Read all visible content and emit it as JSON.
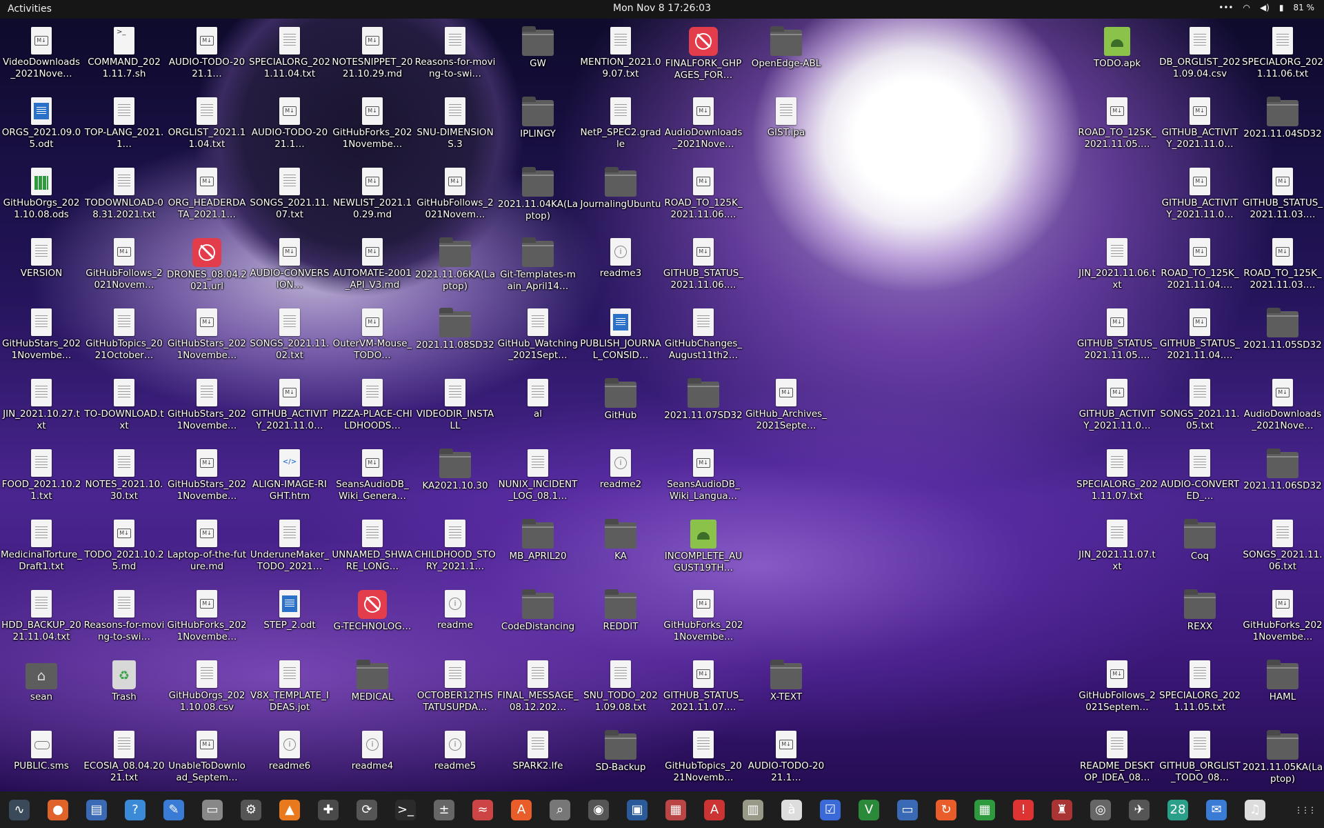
{
  "topbar": {
    "activities": "Activities",
    "clock": "Mon Nov 8  17:26:03",
    "battery": "81 %"
  },
  "icons": [
    {
      "label": "VideoDownloads_2021Nove…",
      "type": "md"
    },
    {
      "label": "COMMAND_2021.11.7.sh",
      "type": "term"
    },
    {
      "label": "AUDIO-TODO-2021.1…",
      "type": "md"
    },
    {
      "label": "SPECIALORG_2021.11.04.txt",
      "type": "doc"
    },
    {
      "label": "NOTESNIPPET_2021.10.29.md",
      "type": "md"
    },
    {
      "label": "Reasons-for-moving-to-swi…",
      "type": "doc"
    },
    {
      "label": "GW",
      "type": "folder"
    },
    {
      "label": "MENTION_2021.09.07.txt",
      "type": "doc"
    },
    {
      "label": "FINALFORK_GHPAGES_FOR…",
      "type": "red"
    },
    {
      "label": "OpenEdge-ABL",
      "type": "folder"
    },
    {
      "label": "TODO.apk",
      "type": "apk"
    },
    {
      "label": "DB_ORGLIST_2021.09.04.csv",
      "type": "doc"
    },
    {
      "label": "SPECIALORG_2021.11.06.txt",
      "type": "doc"
    },
    {
      "label": "ORGS_2021.09.05.odt",
      "type": "odt"
    },
    {
      "label": "TOP-LANG_2021.1…",
      "type": "doc"
    },
    {
      "label": "ORGLIST_2021.11.04.txt",
      "type": "doc"
    },
    {
      "label": "AUDIO-TODO-2021.1…",
      "type": "md"
    },
    {
      "label": "GitHubForks_2021Novembe…",
      "type": "md"
    },
    {
      "label": "SNU-DIMENSIONS.3",
      "type": "doc"
    },
    {
      "label": "IPLINGY",
      "type": "folder"
    },
    {
      "label": "NetP_SPEC2.gradle",
      "type": "doc"
    },
    {
      "label": "AudioDownloads_2021Nove…",
      "type": "md"
    },
    {
      "label": "GIST.ipa",
      "type": "doc"
    },
    {
      "label": "ROAD_TO_125K_2021.11.05.…",
      "type": "md"
    },
    {
      "label": "GITHUB_ACTIVITY_2021.11.0…",
      "type": "md"
    },
    {
      "label": "2021.11.04SD32",
      "type": "folder"
    },
    {
      "label": "GitHubOrgs_2021.10.08.ods",
      "type": "ods"
    },
    {
      "label": "TODOWNLOAD-08.31.2021.txt",
      "type": "doc"
    },
    {
      "label": "ORG_HEADERDATA_2021.1…",
      "type": "md"
    },
    {
      "label": "SONGS_2021.11.07.txt",
      "type": "doc"
    },
    {
      "label": "NEWLIST_2021.10.29.md",
      "type": "md"
    },
    {
      "label": "GitHubFollows_2021Novem…",
      "type": "md"
    },
    {
      "label": "2021.11.04KA(Laptop)",
      "type": "folder"
    },
    {
      "label": "JournalingUbuntu",
      "type": "folder"
    },
    {
      "label": "ROAD_TO_125K_2021.11.06.…",
      "type": "md"
    },
    {
      "label": "GITHUB_ACTIVITY_2021.11.0…",
      "type": "md"
    },
    {
      "label": "GITHUB_STATUS_2021.11.03.…",
      "type": "md"
    },
    {
      "label": "VERSION",
      "type": "doc"
    },
    {
      "label": "GitHubFollows_2021Novem…",
      "type": "md"
    },
    {
      "label": "DRONES_08.04.2021.url",
      "type": "red"
    },
    {
      "label": "AUDIO-CONVERSION…",
      "type": "md"
    },
    {
      "label": "AUTOMATE-2001_API_V3.md",
      "type": "md"
    },
    {
      "label": "2021.11.06KA(Laptop)",
      "type": "folder"
    },
    {
      "label": "Git-Templates-main_April14…",
      "type": "folder"
    },
    {
      "label": "readme3",
      "type": "info"
    },
    {
      "label": "GITHUB_STATUS_2021.11.06.…",
      "type": "md"
    },
    {
      "label": "JIN_2021.11.06.txt",
      "type": "doc"
    },
    {
      "label": "ROAD_TO_125K_2021.11.04.…",
      "type": "md"
    },
    {
      "label": "ROAD_TO_125K_2021.11.03.…",
      "type": "md"
    },
    {
      "label": "GitHubStars_2021Novembe…",
      "type": "doc"
    },
    {
      "label": "GitHubTopics_2021October…",
      "type": "doc"
    },
    {
      "label": "GitHubStars_2021Novembe…",
      "type": "md"
    },
    {
      "label": "SONGS_2021.11.02.txt",
      "type": "doc"
    },
    {
      "label": "OuterVM-Mouse_TODO…",
      "type": "md"
    },
    {
      "label": "2021.11.08SD32",
      "type": "folder"
    },
    {
      "label": "GitHub_Watching_2021Sept…",
      "type": "doc"
    },
    {
      "label": "PUBLISH_JOURNAL_CONSID…",
      "type": "odt"
    },
    {
      "label": "GitHubChanges_August11th2…",
      "type": "doc"
    },
    {
      "label": "GITHUB_STATUS_2021.11.05.…",
      "type": "md"
    },
    {
      "label": "GITHUB_STATUS_2021.11.04.…",
      "type": "md"
    },
    {
      "label": "2021.11.05SD32",
      "type": "folder"
    },
    {
      "label": "JIN_2021.10.27.txt",
      "type": "doc"
    },
    {
      "label": "TO-DOWNLOAD.txt",
      "type": "doc"
    },
    {
      "label": "GitHubStars_2021Novembe…",
      "type": "doc"
    },
    {
      "label": "GITHUB_ACTIVITY_2021.11.0…",
      "type": "md"
    },
    {
      "label": "PIZZA-PLACE-CHILDHOODS…",
      "type": "doc"
    },
    {
      "label": "VIDEODIR_INSTALL",
      "type": "doc"
    },
    {
      "label": "al",
      "type": "doc"
    },
    {
      "label": "GitHub",
      "type": "folder"
    },
    {
      "label": "2021.11.07SD32",
      "type": "folder"
    },
    {
      "label": "GitHub_Archives_2021Septe…",
      "type": "md"
    },
    {
      "label": "GITHUB_ACTIVITY_2021.11.0…",
      "type": "md"
    },
    {
      "label": "SONGS_2021.11.05.txt",
      "type": "doc"
    },
    {
      "label": "AudioDownloads_2021Nove…",
      "type": "md"
    },
    {
      "label": "FOOD_2021.10.21.txt",
      "type": "doc"
    },
    {
      "label": "NOTES_2021.10.30.txt",
      "type": "doc"
    },
    {
      "label": "GitHubStars_2021Novembe…",
      "type": "md"
    },
    {
      "label": "ALIGN-IMAGE-RIGHT.htm",
      "type": "htm"
    },
    {
      "label": "SeansAudioDB_Wiki_Genera…",
      "type": "md"
    },
    {
      "label": "KA2021.10.30",
      "type": "folder"
    },
    {
      "label": "NUNIX_INCIDENT_LOG_08.1…",
      "type": "doc"
    },
    {
      "label": "readme2",
      "type": "info"
    },
    {
      "label": "SeansAudioDB_Wiki_Langua…",
      "type": "md"
    },
    {
      "label": "SPECIALORG_2021.11.07.txt",
      "type": "doc"
    },
    {
      "label": "AUDIO-CONVERTED_…",
      "type": "doc"
    },
    {
      "label": "2021.11.06SD32",
      "type": "folder"
    },
    {
      "label": "MedicinalTorture_Draft1.txt",
      "type": "doc"
    },
    {
      "label": "TODO_2021.10.25.md",
      "type": "md"
    },
    {
      "label": "Laptop-of-the-future.md",
      "type": "md"
    },
    {
      "label": "UnderuneMaker_TODO_2021…",
      "type": "doc"
    },
    {
      "label": "UNNAMED_SHWARE_LONG…",
      "type": "doc"
    },
    {
      "label": "CHILDHOOD_STORY_2021.1…",
      "type": "doc"
    },
    {
      "label": "MB_APRIL20",
      "type": "folder"
    },
    {
      "label": "KA",
      "type": "folder"
    },
    {
      "label": "INCOMPLETE_AUGUST19TH…",
      "type": "apk"
    },
    {
      "label": "JIN_2021.11.07.txt",
      "type": "doc"
    },
    {
      "label": "Coq",
      "type": "folder"
    },
    {
      "label": "SONGS_2021.11.06.txt",
      "type": "doc"
    },
    {
      "label": "HDD_BACKUP_2021.11.04.txt",
      "type": "doc"
    },
    {
      "label": "Reasons-for-moving-to-swi…",
      "type": "doc"
    },
    {
      "label": "GitHubForks_2021Novembe…",
      "type": "md"
    },
    {
      "label": "STEP_2.odt",
      "type": "odt"
    },
    {
      "label": "G-TECHNOLOG…",
      "type": "red"
    },
    {
      "label": "readme",
      "type": "info"
    },
    {
      "label": "CodeDistancing",
      "type": "folder"
    },
    {
      "label": "REDDIT",
      "type": "folder"
    },
    {
      "label": "GitHubForks_2021Novembe…",
      "type": "md"
    },
    {
      "label": "REXX",
      "type": "folder"
    },
    {
      "label": "GitHubForks_2021Novembe…",
      "type": "md"
    },
    {
      "label": "sean",
      "type": "home"
    },
    {
      "label": "Trash",
      "type": "trash"
    },
    {
      "label": "GitHubOrgs_2021.10.08.csv",
      "type": "doc"
    },
    {
      "label": "V8X_TEMPLATE_IDEAS.jot",
      "type": "doc"
    },
    {
      "label": "MEDICAL",
      "type": "folder"
    },
    {
      "label": "OCTOBER12THSTATUSUPDA…",
      "type": "doc"
    },
    {
      "label": "FINAL_MESSAGE_08.12.202…",
      "type": "doc"
    },
    {
      "label": "SNU_TODO_2021.09.08.txt",
      "type": "doc"
    },
    {
      "label": "GITHUB_STATUS_2021.11.07.…",
      "type": "md"
    },
    {
      "label": "X-TEXT",
      "type": "folder"
    },
    {
      "label": "GitHubFollows_2021Septem…",
      "type": "md"
    },
    {
      "label": "SPECIALORG_2021.11.05.txt",
      "type": "doc"
    },
    {
      "label": "HAML",
      "type": "folder"
    },
    {
      "label": "PUBLIC.sms",
      "type": "game"
    },
    {
      "label": "ECOSIA_08.04.2021.txt",
      "type": "doc"
    },
    {
      "label": "UnableToDownload_Septem…",
      "type": "md"
    },
    {
      "label": "readme6",
      "type": "info"
    },
    {
      "label": "readme4",
      "type": "info"
    },
    {
      "label": "readme5",
      "type": "info"
    },
    {
      "label": "SPARK2.lfe",
      "type": "doc"
    },
    {
      "label": "SD-Backup",
      "type": "folder"
    },
    {
      "label": "GitHubTopics_2021Novemb…",
      "type": "doc"
    },
    {
      "label": "AUDIO-TODO-2021.1…",
      "type": "md"
    },
    {
      "label": "README_DESKTOP_IDEA_08…",
      "type": "doc"
    },
    {
      "label": "GITHUB_ORGLIST_TODO_08…",
      "type": "doc"
    },
    {
      "label": "2021.11.05KA(Laptop)",
      "type": "folder"
    }
  ],
  "dock": [
    {
      "name": "system-monitor-icon",
      "glyph": "∿",
      "color": "#3a4a5a"
    },
    {
      "name": "firefox-icon",
      "glyph": "●",
      "color": "#e0632a"
    },
    {
      "name": "document-viewer-icon",
      "glyph": "▤",
      "color": "#3a6ab5"
    },
    {
      "name": "help-icon",
      "glyph": "?",
      "color": "#3a8ad8"
    },
    {
      "name": "text-editor-icon",
      "glyph": "✎",
      "color": "#3a7bd5"
    },
    {
      "name": "files-icon",
      "glyph": "▭",
      "color": "#888"
    },
    {
      "name": "settings-icon",
      "glyph": "⚙",
      "color": "#555"
    },
    {
      "name": "vlc-icon",
      "glyph": "▲",
      "color": "#e8791c"
    },
    {
      "name": "extensions-icon",
      "glyph": "✚",
      "color": "#4a4a4a"
    },
    {
      "name": "updater-icon",
      "glyph": "⟳",
      "color": "#555"
    },
    {
      "name": "terminal-icon",
      "glyph": ">_",
      "color": "#2b2b2b"
    },
    {
      "name": "calculator-icon",
      "glyph": "±",
      "color": "#666"
    },
    {
      "name": "audio-editor-icon",
      "glyph": "≈",
      "color": "#c44"
    },
    {
      "name": "software-center-icon",
      "glyph": "A",
      "color": "#e85d2a"
    },
    {
      "name": "search-tool-icon",
      "glyph": "⌕",
      "color": "#777"
    },
    {
      "name": "disk-icon",
      "glyph": "◉",
      "color": "#555"
    },
    {
      "name": "image-viewer-icon",
      "glyph": "▣",
      "color": "#2a5a9a"
    },
    {
      "name": "screenshot-icon",
      "glyph": "▦",
      "color": "#b44"
    },
    {
      "name": "pdf-icon",
      "glyph": "A",
      "color": "#c33"
    },
    {
      "name": "archive-icon",
      "glyph": "▥",
      "color": "#998"
    },
    {
      "name": "character-map-icon",
      "glyph": "à",
      "color": "#ddd"
    },
    {
      "name": "tasks-icon",
      "glyph": "☑",
      "color": "#3a6ad8"
    },
    {
      "name": "vim-icon",
      "glyph": "V",
      "color": "#2a8a3a"
    },
    {
      "name": "display-icon",
      "glyph": "▭",
      "color": "#3a6ab5"
    },
    {
      "name": "backup-icon",
      "glyph": "↻",
      "color": "#e85d2a"
    },
    {
      "name": "spreadsheet-icon",
      "glyph": "▦",
      "color": "#2e9a3e"
    },
    {
      "name": "alert-icon",
      "glyph": "!",
      "color": "#d33"
    },
    {
      "name": "game-icon",
      "glyph": "♜",
      "color": "#a33"
    },
    {
      "name": "camera-icon",
      "glyph": "◎",
      "color": "#666"
    },
    {
      "name": "feather-icon",
      "glyph": "✈",
      "color": "#555"
    },
    {
      "name": "calendar-icon",
      "glyph": "28",
      "color": "#2aa08a"
    },
    {
      "name": "mail-icon",
      "glyph": "✉",
      "color": "#3a7bd5"
    },
    {
      "name": "music-icon",
      "glyph": "♫",
      "color": "#ddd"
    },
    {
      "name": "show-apps-icon",
      "glyph": "⋮⋮⋮",
      "color": "#1e1e1e"
    }
  ]
}
